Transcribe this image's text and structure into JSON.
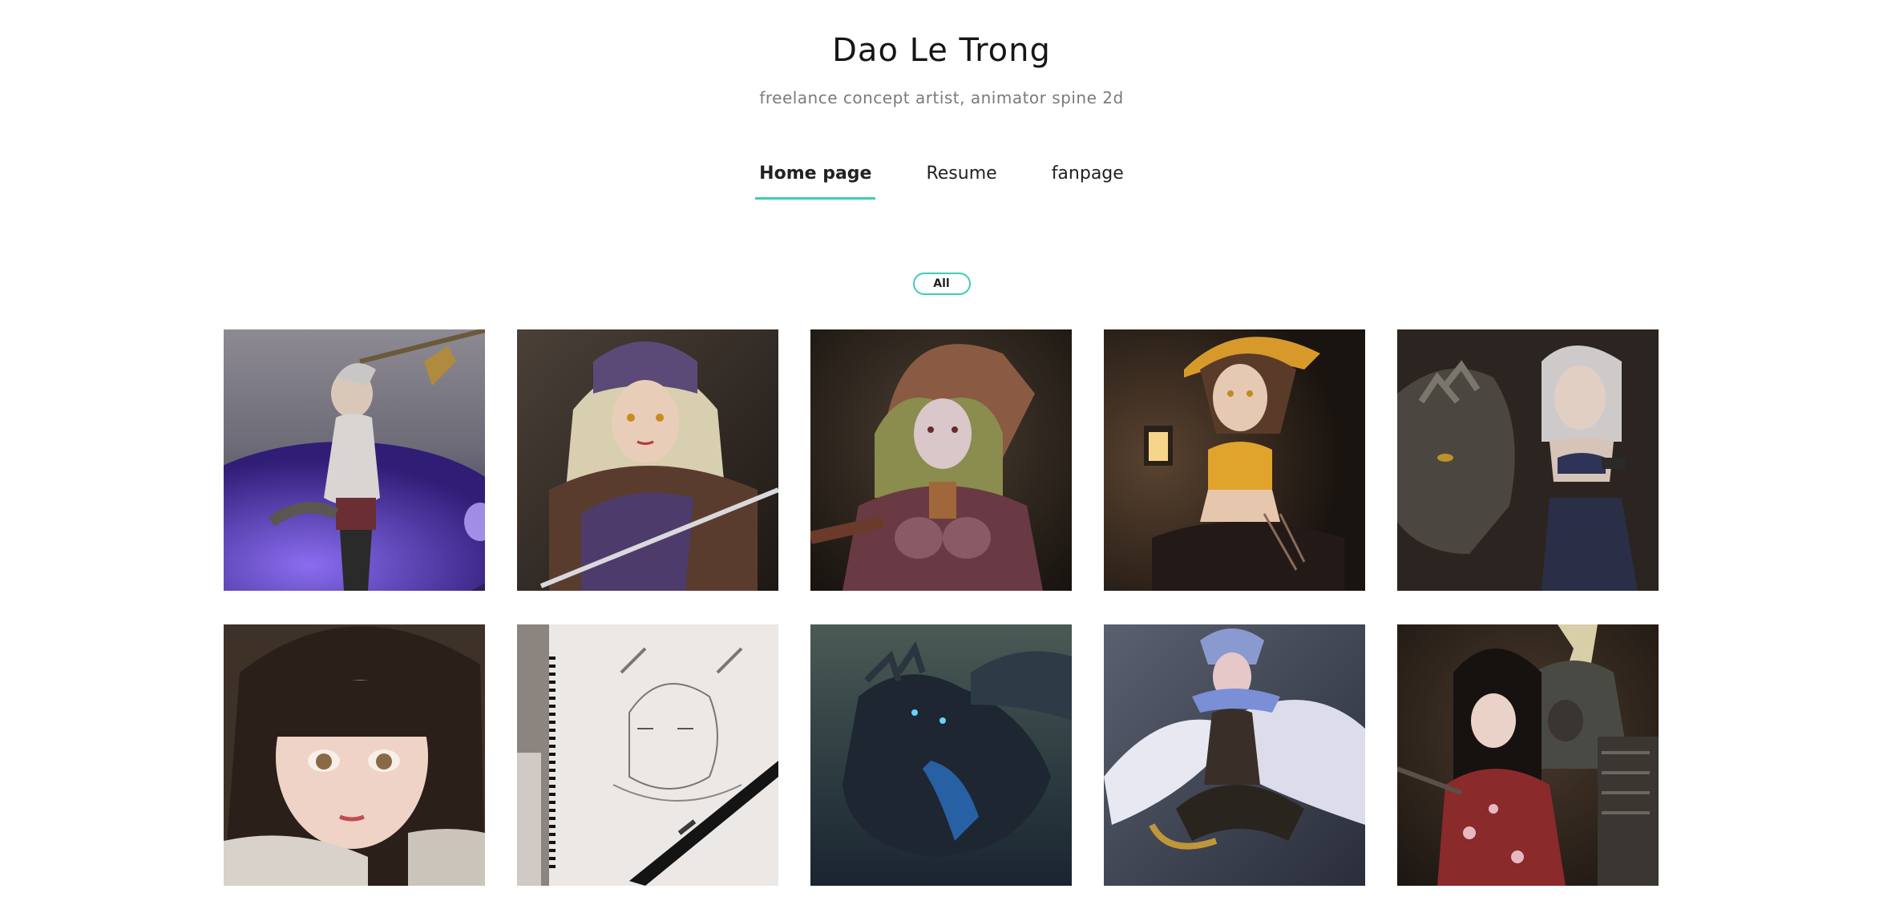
{
  "header": {
    "title": "Dao Le Trong",
    "subtitle": "freelance concept artist, animator spine 2d"
  },
  "nav": {
    "items": [
      {
        "label": "Home page",
        "active": true
      },
      {
        "label": "Resume",
        "active": false
      },
      {
        "label": "fanpage",
        "active": false
      }
    ]
  },
  "filter": {
    "label": "All"
  },
  "colors": {
    "accent": "#3ecdb5"
  },
  "gallery": {
    "items": [
      {
        "name": "warrior-with-sword-artwork"
      },
      {
        "name": "armored-knight-girl-artwork"
      },
      {
        "name": "hooded-elf-archer-artwork"
      },
      {
        "name": "witch-with-lantern-artwork"
      },
      {
        "name": "girl-with-dragon-artwork"
      },
      {
        "name": "dark-hair-girl-portrait-artwork"
      },
      {
        "name": "pencil-sketch-notebook-artwork"
      },
      {
        "name": "dark-dragon-artwork"
      },
      {
        "name": "winged-heroine-artwork"
      },
      {
        "name": "samurai-and-kimono-girl-artwork"
      }
    ]
  }
}
